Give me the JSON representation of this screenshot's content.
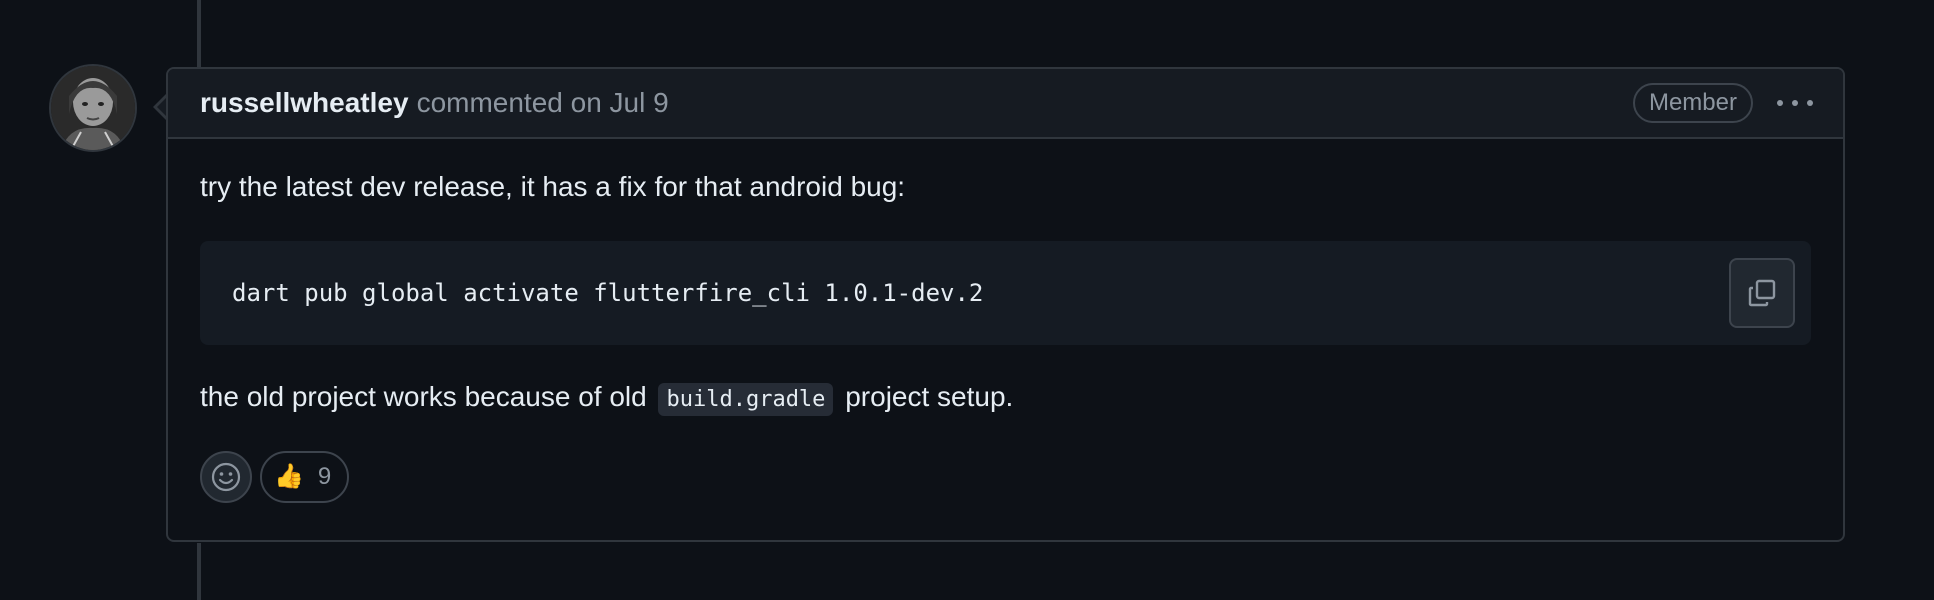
{
  "comment": {
    "author": "russellwheatley",
    "meta": "commented on Jul 9",
    "role_badge": "Member",
    "more_icon": "kebab-horizontal-icon",
    "body": {
      "para1": "try the latest dev release, it has a fix for that android bug:",
      "code": "dart pub global activate flutterfire_cli 1.0.1-dev.2",
      "copy_icon": "copy-icon",
      "para2_before": "the old project works because of old",
      "para2_code": "build.gradle",
      "para2_after": "project setup."
    },
    "reactions": {
      "add_icon": "smiley-icon",
      "items": [
        {
          "emoji": "👍",
          "icon": "thumbs-up-icon",
          "count": "9"
        }
      ]
    }
  },
  "colors": {
    "background": "#0d1117",
    "header": "#161b22",
    "border": "#30363d",
    "text": "#e6edf3",
    "muted": "#8d96a0"
  }
}
